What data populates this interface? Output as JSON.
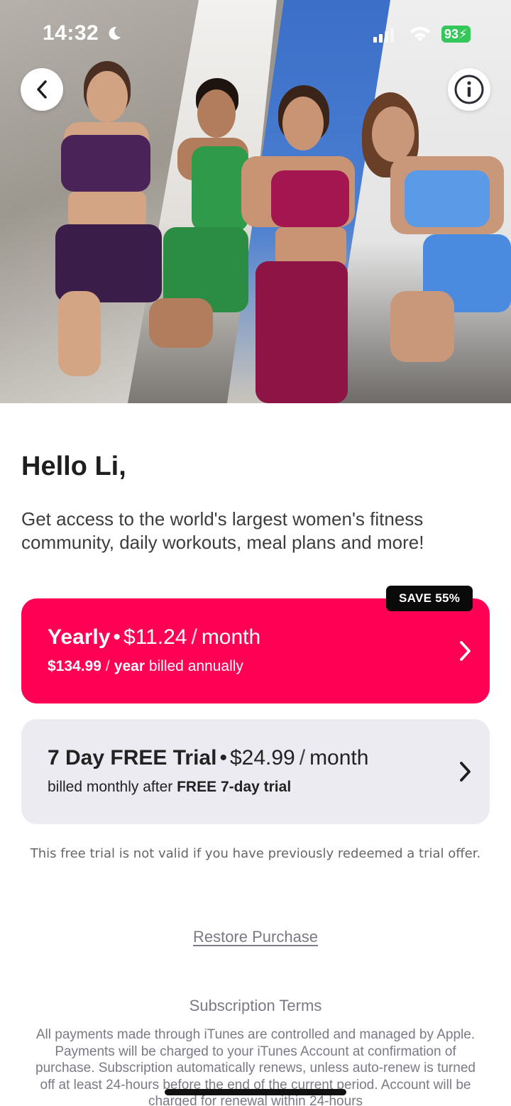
{
  "status_bar": {
    "time": "14:32",
    "battery": "93",
    "icons": [
      "moon-icon",
      "signal-icon",
      "wifi-icon",
      "battery-charging-icon"
    ]
  },
  "hero": {
    "back_icon": "chevron-left-icon",
    "info_icon": "info-icon"
  },
  "greeting": "Hello Li,",
  "subtitle": "Get access to the world's largest women's fitness community, daily workouts, meal plans and more!",
  "plans": [
    {
      "title": "Yearly",
      "price": "$11.24",
      "period": "month",
      "sub_price": "$134.99",
      "sub_unit": "year",
      "sub_text": "billed annually",
      "badge": "SAVE 55%",
      "color": "#ff0055"
    },
    {
      "title": "7 Day FREE Trial",
      "price": "$24.99",
      "period": "month",
      "sub_text": "billed monthly after",
      "sub_bold": "FREE 7-day trial",
      "color": "#ebebf1"
    }
  ],
  "separators": {
    "dot": "•",
    "slash": "/"
  },
  "trial_note": "This free trial is not valid if you have previously redeemed a trial offer.",
  "restore_label": "Restore Purchase",
  "terms": {
    "title": "Subscription Terms",
    "body": "All payments made through iTunes are controlled and managed by Apple. Payments will be charged to your iTunes Account at confirmation of purchase. Subscription automatically renews, unless auto-renew is turned off at least 24-hours before the end of the current period. Account will be charged for renewal within 24-hours"
  }
}
